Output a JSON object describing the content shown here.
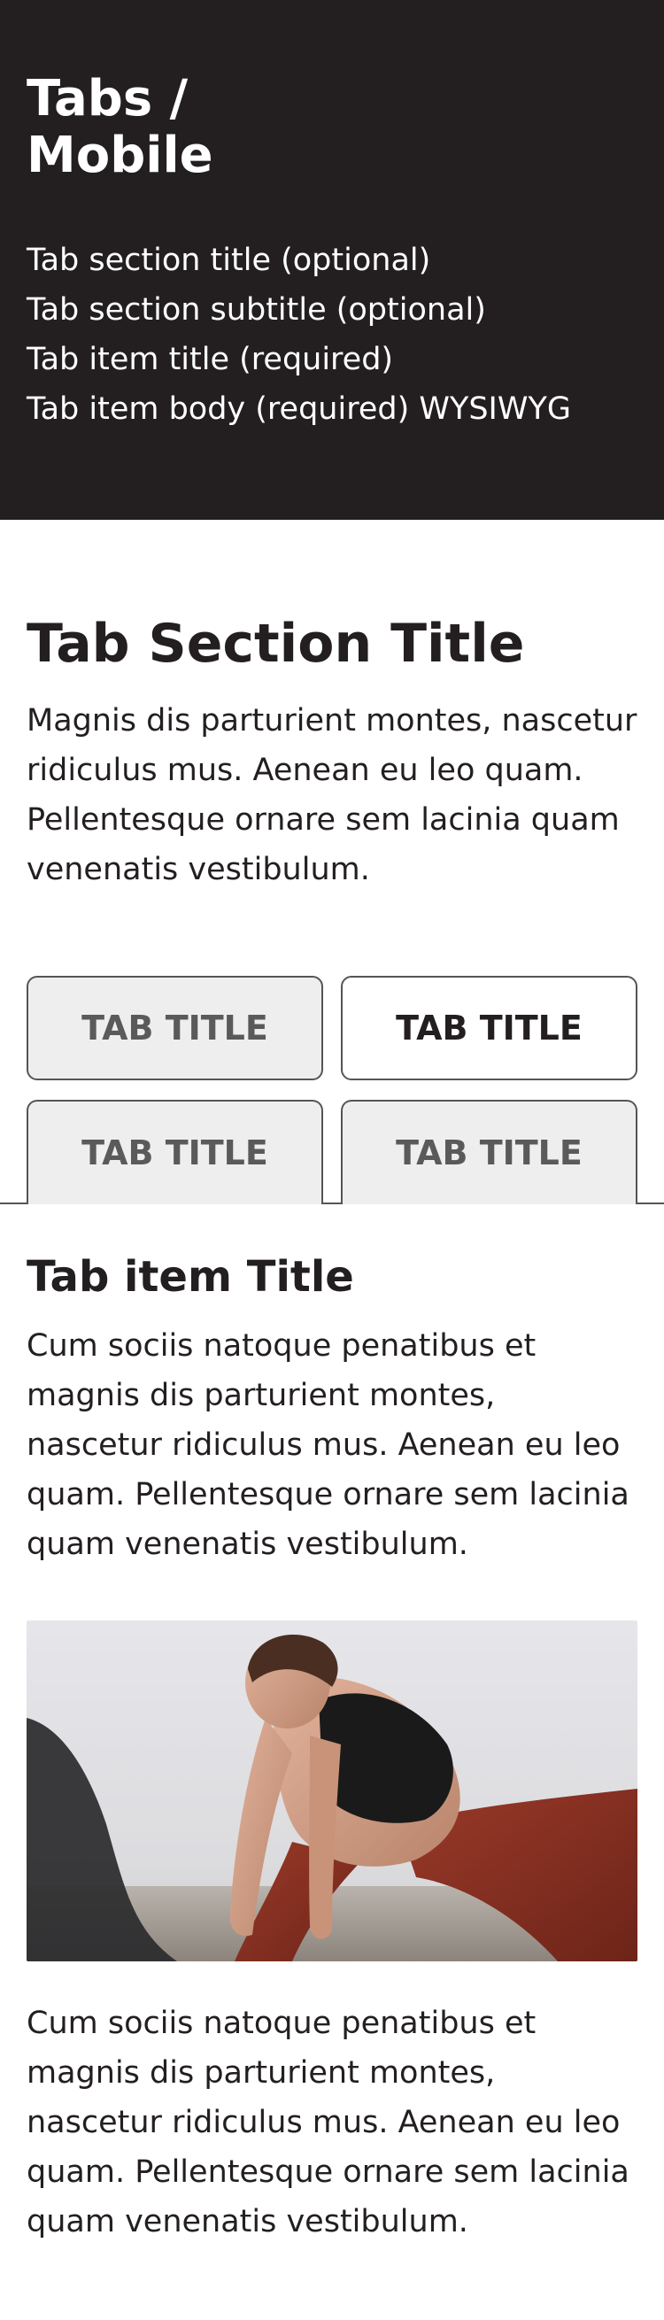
{
  "hero": {
    "title_line1": "Tabs /",
    "title_line2": "Mobile",
    "fields": [
      "Tab section title (optional)",
      "Tab section subtitle (optional)",
      "Tab item title (required)",
      "Tab item body (required) WYSIWYG"
    ]
  },
  "section": {
    "title": "Tab Section Title",
    "subtitle": "Magnis dis parturient montes, nascetur ridiculus mus. Aenean eu leo quam. Pellentesque ornare sem lacinia quam venenatis vestibulum."
  },
  "tabs": [
    {
      "label": "TAB TITLE",
      "active": false
    },
    {
      "label": "TAB TITLE",
      "active": true
    },
    {
      "label": "TAB TITLE",
      "active": false
    },
    {
      "label": "TAB TITLE",
      "active": false
    }
  ],
  "panel": {
    "title": "Tab item Title",
    "body": "Cum sociis natoque penatibus et magnis dis parturient montes, nascetur ridiculus mus. Aenean eu leo quam. Pellentesque ornare sem lacinia quam venenatis vestibulum.",
    "body_2": "Cum sociis natoque penatibus et magnis dis parturient montes, nascetur ridiculus mus. Aenean eu leo quam. Pellentesque ornare sem lacinia quam venenatis vestibulum."
  },
  "colors": {
    "hero_bg": "#231f20",
    "tab_inactive_bg": "#eeeeee",
    "tab_border": "#555555"
  }
}
